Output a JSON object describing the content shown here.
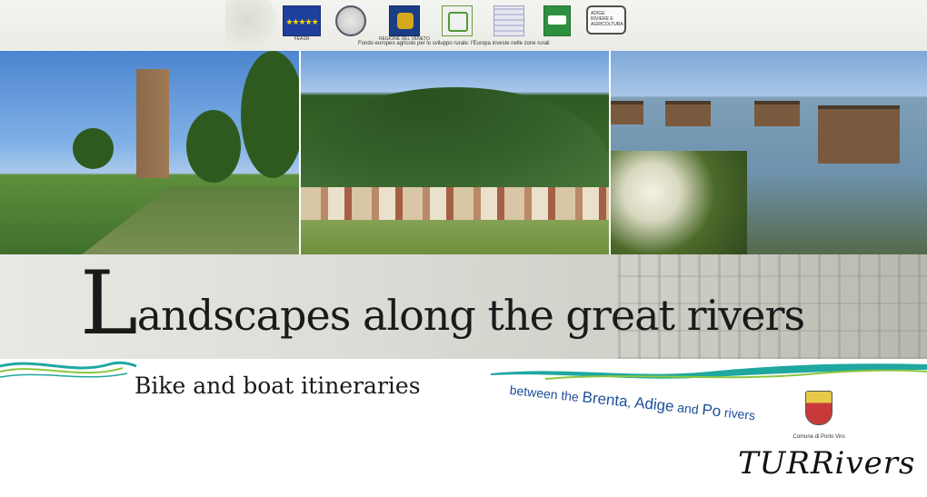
{
  "header": {
    "logos": {
      "eu": {
        "label": "FEASR",
        "stars": "★★★★★"
      },
      "italy": {
        "icon": "italian-republic-emblem"
      },
      "veneto": {
        "label": "REGIONE DEL VENETO"
      },
      "leader": {
        "icon": "leader-logo"
      },
      "psr": {
        "icon": "psr-logo"
      },
      "region_flag": {
        "icon": "regional-flag-logo"
      },
      "gal": {
        "label": "ADIGE RIVIERE E AGRICOLTURA"
      }
    },
    "caption": "Fondo europeo agricolo per lo sviluppo rurale: l'Europa investe nelle zone rurali"
  },
  "title": {
    "initial": "L",
    "rest": "andscapes along the great rivers"
  },
  "subtitle": "Bike and boat itineraries",
  "tagline": {
    "p1": "between the ",
    "r1": "Brenta",
    "sep1": ", ",
    "r2": "Adige",
    "p2": " and ",
    "r3": "Po",
    "p3": " rivers"
  },
  "footer": {
    "municipality": "Comune di Porto Viro",
    "brand": "TURRivers"
  },
  "colors": {
    "accent": "#1d4f9a",
    "wave_teal": "#1fa7a0",
    "wave_green": "#8cc63f",
    "text": "#1a1a1a"
  }
}
